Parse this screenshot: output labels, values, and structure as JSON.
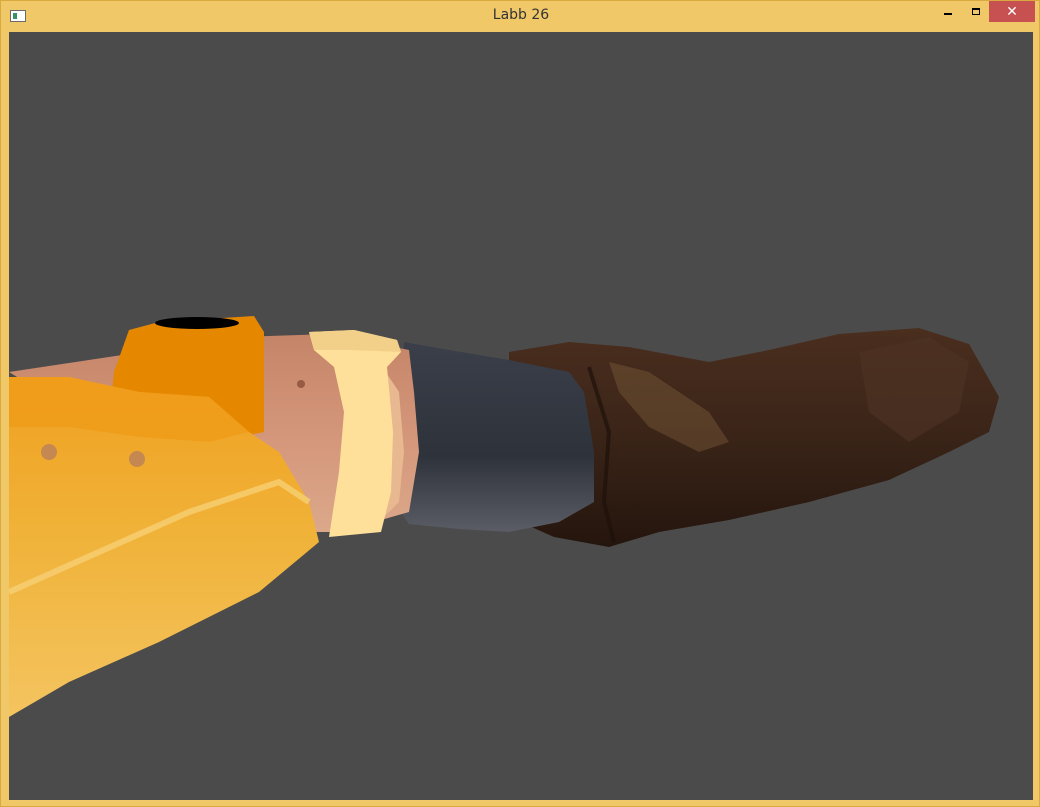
{
  "window": {
    "title": "Labb 26",
    "icon": "app-window-icon",
    "controls": {
      "minimize_icon": "minimize-icon",
      "maximize_icon": "maximize-icon",
      "close_icon": "close-icon",
      "close_glyph": "✕"
    }
  },
  "scene": {
    "background_color": "#4b4b4b",
    "colors": {
      "jacket_orange": "#e58800",
      "jacket_yellow": "#f0b238",
      "skin": "#d4967a",
      "cuff": "#ffe09a",
      "sock": "#2e323a",
      "boot": "#3a2418"
    }
  }
}
